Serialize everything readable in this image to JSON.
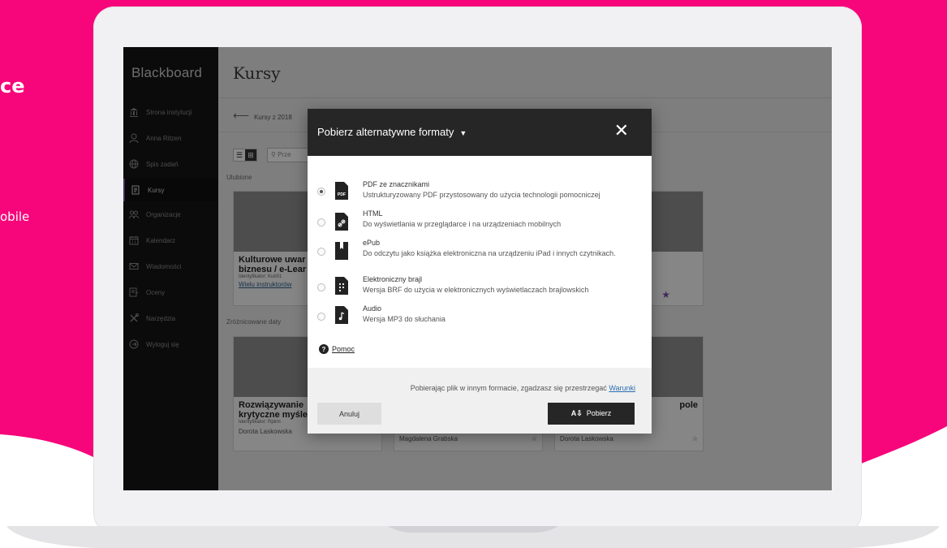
{
  "colors": {
    "brand_pink": "#f7057a",
    "sidebar": "#141414",
    "modal_header": "#262626",
    "link": "#2b6db0"
  },
  "background": {
    "headline_fragment": "ce",
    "line_fragment": "obile"
  },
  "app": {
    "logo": "Blackboard",
    "page_title": "Kursy",
    "breadcrumb": "Kursy z 2018",
    "search_placeholder": "Prze",
    "sidebar": {
      "items": [
        {
          "label": "Strona instytucji",
          "icon": "institution-icon"
        },
        {
          "label": "Anna Ritzen",
          "icon": "user-icon"
        },
        {
          "label": "Spis zadań",
          "icon": "globe-icon"
        },
        {
          "label": "Kursy",
          "icon": "courses-icon",
          "active": true
        },
        {
          "label": "Organizacje",
          "icon": "groups-icon"
        },
        {
          "label": "Kalendarz",
          "icon": "calendar-icon"
        },
        {
          "label": "Wiadomości",
          "icon": "mail-icon"
        },
        {
          "label": "Oceny",
          "icon": "grades-icon"
        },
        {
          "label": "Narzędzia",
          "icon": "tools-icon"
        },
        {
          "label": "Wyloguj się",
          "icon": "logout-icon"
        }
      ]
    },
    "sections": {
      "favorites": "Ulubione",
      "mixed_dates": "Zróżnicowane daty"
    },
    "cards": [
      {
        "title1": "Kulturowe uwar",
        "title2": "biznesu / e-Lear",
        "meta": "Identyfikator: Kub01",
        "link": "Wielu instruktorów"
      },
      {
        "title1": "Rozwiązywanie",
        "title2": "krytyczne myśle",
        "meta": "Identyfikator: Rpkm",
        "instructor": "Dorota Laskowska"
      },
      {
        "instructor": "Magdalena Grabska"
      },
      {
        "title1": "pole",
        "instructor": "Dorota Laskowska"
      }
    ]
  },
  "modal": {
    "title": "Pobierz alternatywne formaty",
    "close": "✕",
    "options": [
      {
        "title": "PDF ze znacznikami",
        "desc": "Ustrukturyzowany PDF przystosowany do użycia technologii pomocniczej",
        "icon": "pdf-file-icon",
        "selected": true,
        "badge": "PDF"
      },
      {
        "title": "HTML",
        "desc": "Do wyświetlania w przeglądarce i na urządzeniach mobilnych",
        "icon": "html-file-icon",
        "selected": false
      },
      {
        "title": "ePub",
        "desc": "Do odczytu jako książka elektroniczna na urządzeniu iPad i innych czytnikach.",
        "icon": "epub-book-icon",
        "selected": false
      },
      {
        "title": "Elektroniczny brajl",
        "desc": "Wersja BRF do użycia w elektronicznych wyświetlaczach brajlowskich",
        "icon": "braille-file-icon",
        "selected": false
      },
      {
        "title": "Audio",
        "desc": "Wersja MP3 do słuchania",
        "icon": "audio-file-icon",
        "selected": false
      }
    ],
    "help": "Pomoc",
    "terms_text": "Pobierając plik w innym formacie, zgadzasz się przestrzegać ",
    "terms_link": "Warunki",
    "cancel": "Anuluj",
    "download": "Pobierz"
  }
}
